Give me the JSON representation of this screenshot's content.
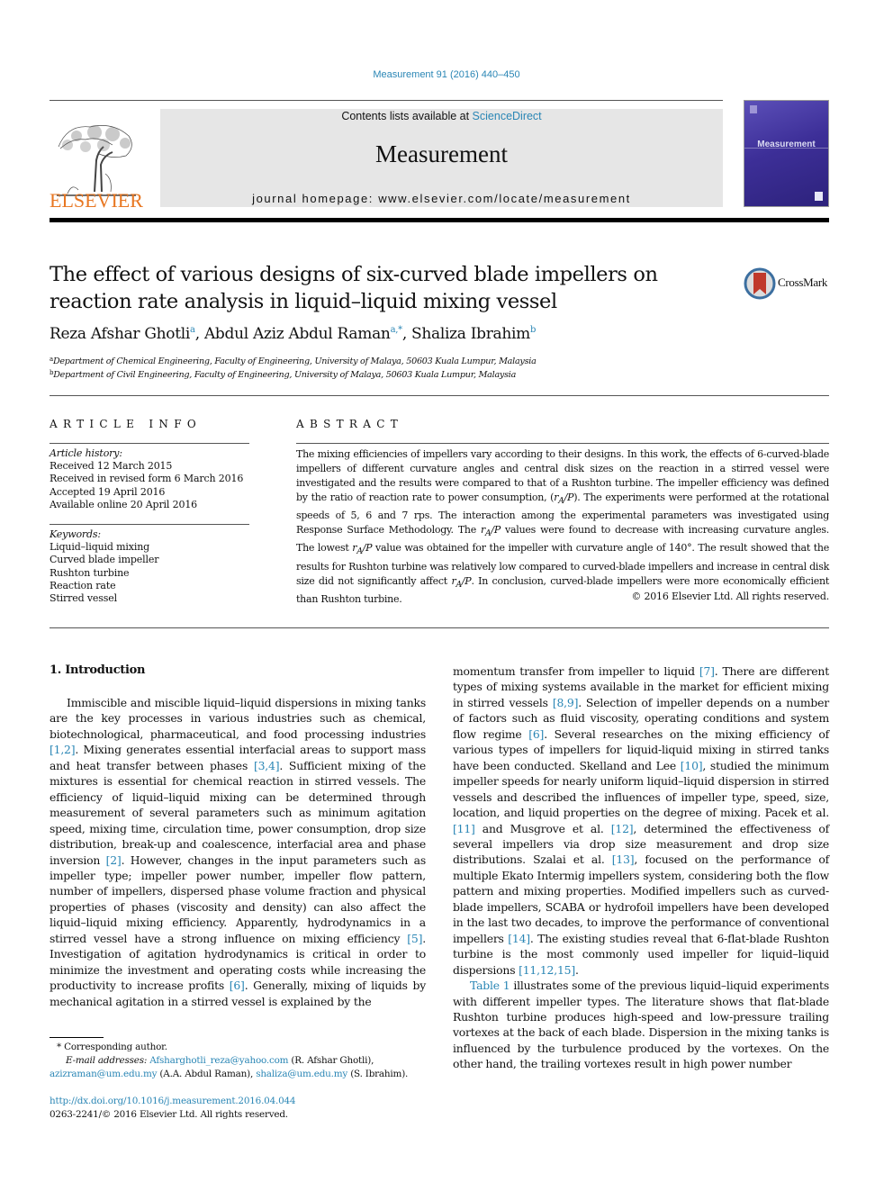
{
  "header": {
    "citation": "Measurement 91 (2016) 440–450",
    "contents_prefix": "Contents lists available at ",
    "contents_link": "ScienceDirect",
    "journal_title": "Measurement",
    "homepage": "journal homepage: www.elsevier.com/locate/measurement",
    "publisher_logo_text": "ELSEVIER",
    "cover_title": "Measurement",
    "crossmark_label": "CrossMark"
  },
  "article": {
    "title": "The effect of various designs of six-curved blade impellers on reaction rate analysis in liquid–liquid mixing vessel",
    "authors": [
      {
        "name": "Reza Afshar Ghotli",
        "sup": "a"
      },
      {
        "name": "Abdul Aziz Abdul Raman",
        "sup": "a,*"
      },
      {
        "name": "Shaliza Ibrahim",
        "sup": "b"
      }
    ],
    "affiliations": [
      {
        "key": "a",
        "text": "Department of Chemical Engineering, Faculty of Engineering, University of Malaya, 50603 Kuala Lumpur, Malaysia"
      },
      {
        "key": "b",
        "text": "Department of Civil Engineering, Faculty of Engineering, University of Malaya, 50603 Kuala Lumpur, Malaysia"
      }
    ]
  },
  "article_info": {
    "heading": "ARTICLE INFO",
    "history_label": "Article history:",
    "history": [
      "Received 12 March 2015",
      "Received in revised form 6 March 2016",
      "Accepted 19 April 2016",
      "Available online 20 April 2016"
    ],
    "keywords_label": "Keywords:",
    "keywords": [
      "Liquid–liquid mixing",
      "Curved blade impeller",
      "Rushton turbine",
      "Reaction rate",
      "Stirred vessel"
    ]
  },
  "abstract": {
    "heading": "ABSTRACT",
    "parts": {
      "p1": "The mixing efficiencies of impellers vary according to their designs. In this work, the effects of 6-curved-blade impellers of different curvature angles and central disk sizes on the reaction in a stirred vessel were investigated and the results were compared to that of a Rushton turbine. The impeller efficiency was defined by the ratio of reaction rate to power consumption, (",
      "p2": "). The experiments were performed at the rotational speeds of 5, 6 and 7 rps. The interaction among the experimental parameters was investigated using Response Surface Methodology. The ",
      "p3": " values were found to decrease with increasing curvature angles. The lowest ",
      "p4": " value was obtained for the impeller with curvature angle of 140°. The result showed that the results for Rushton turbine was relatively low compared to curved-blade impellers and increase in central disk size did not significantly affect ",
      "p5": ". In conclusion, curved-blade impellers were more economically efficient than Rushton turbine.",
      "r": "r",
      "sub": "A",
      "slashP": "/P"
    },
    "copyright": "© 2016 Elsevier Ltd. All rights reserved."
  },
  "body": {
    "section_heading": "1. Introduction",
    "left": {
      "s1": "Immiscible and miscible liquid–liquid dispersions in mixing tanks are the key processes in various industries such as chemical, biotechnological, pharmaceutical, and food processing industries ",
      "r1": "[1,2]",
      "s2": ". Mixing generates essential interfacial areas to support mass and heat transfer between phases ",
      "r2": "[3,4]",
      "s3": ". Sufficient mixing of the mixtures is essential for chemical reaction in stirred vessels. The efficiency of liquid–liquid mixing can be determined through measurement of several parameters such as minimum agitation speed, mixing time, circulation time, power consumption, drop size distribution, break-up and coalescence, interfacial area and phase inversion ",
      "r3": "[2]",
      "s4": ". However, changes in the input parameters such as impeller type; impeller power number, impeller flow pattern, number of impellers, dispersed phase volume fraction and physical properties of phases (viscosity and density) can also affect the liquid–liquid mixing efficiency. Apparently, hydrodynamics in a stirred vessel have a strong influence on mixing efficiency ",
      "r4": "[5]",
      "s5": ". Investigation of agitation hydrodynamics is critical in order to minimize the investment and operating costs while increasing the productivity to increase profits ",
      "r5": "[6]",
      "s6": ". Generally, mixing of liquids by mechanical agitation in a stirred vessel is explained by the"
    },
    "right": {
      "s1": "momentum transfer from impeller to liquid ",
      "r1": "[7]",
      "s2": ". There are different types of mixing systems available in the market for efficient mixing in stirred vessels ",
      "r2": "[8,9]",
      "s3": ". Selection of impeller depends on a number of factors such as fluid viscosity, operating conditions and system flow regime ",
      "r3": "[6]",
      "s4": ". Several researches on the mixing efficiency of various types of impellers for liquid-liquid mixing in stirred tanks have been conducted. Skelland and Lee ",
      "r4": "[10]",
      "s5": ", studied the minimum impeller speeds for nearly uniform liquid–liquid dispersion in stirred vessels and described the influences of impeller type, speed, size, location, and liquid properties on the degree of mixing. Pacek et al. ",
      "r5": "[11]",
      "s6": " and Musgrove et al. ",
      "r6": "[12]",
      "s7": ", determined the effectiveness of several impellers via drop size measurement and drop size distributions. Szalai et al. ",
      "r7": "[13]",
      "s8": ", focused on the performance of multiple Ekato Intermig impellers system, considering both the flow pattern and mixing properties. Modified impellers such as curved-blade impellers, SCABA or hydrofoil impellers have been developed in the last two decades, to improve the performance of conventional impellers ",
      "r8": "[14]",
      "s9": ". The existing studies reveal that 6-flat-blade Rushton turbine is the most commonly used impeller for liquid–liquid dispersions ",
      "r9": "[11,12,15]",
      "s10": ".",
      "p2_link": "Table 1",
      "p2_text": " illustrates some of the previous liquid–liquid experiments with different impeller types. The literature shows that flat-blade Rushton turbine produces high-speed and low-pressure trailing vortexes at the back of each blade. Dispersion in the mixing tanks is influenced by the turbulence produced by the vortexes. On the other hand, the trailing vortexes result in high power number"
    }
  },
  "footnotes": {
    "corresponding": "* Corresponding author.",
    "email_label": "E-mail addresses: ",
    "emails": [
      {
        "addr": "Afsharghotli_reza@yahoo.com",
        "who": " (R. Afshar Ghotli), "
      },
      {
        "addr": "azizraman@um.edu.my",
        "who": " (A.A. Abdul Raman), "
      },
      {
        "addr": "shaliza@um.edu.my",
        "who": " (S. Ibrahim)."
      }
    ],
    "doi": "http://dx.doi.org/10.1016/j.measurement.2016.04.044",
    "issn": "0263-2241/© 2016 Elsevier Ltd. All rights reserved."
  },
  "colors": {
    "link": "#2a86b5",
    "elsevier_orange": "#e87722",
    "cover_purple": "#3d2f98"
  }
}
